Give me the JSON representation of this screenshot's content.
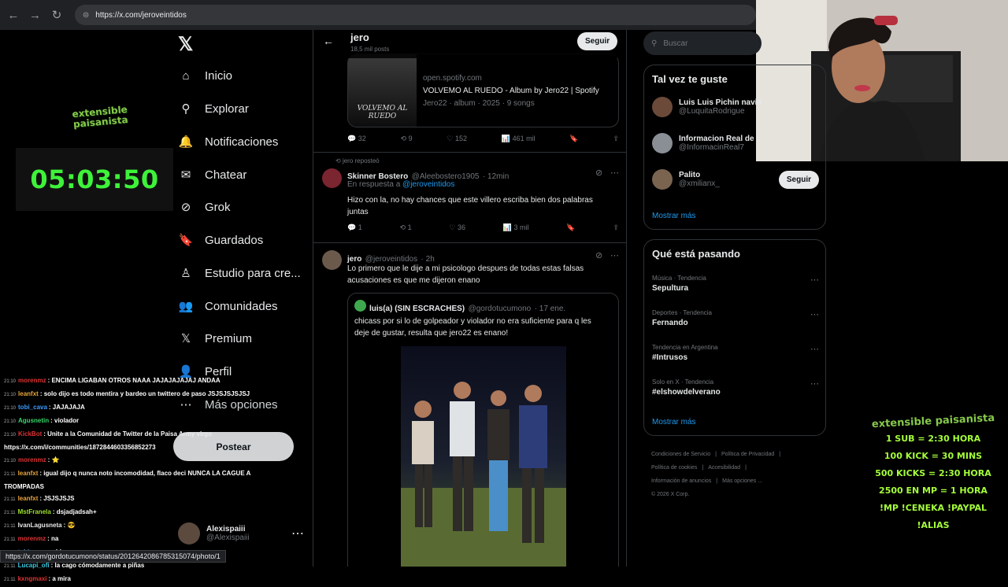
{
  "browser": {
    "url": "https://x.com/jeroveintidos",
    "status_url": "https://x.com/gordotucumono/status/2012642086785315074/photo/1"
  },
  "stream": {
    "logo_text": "extensible paisanista",
    "timer": "05:03:50",
    "chat": [
      {
        "time": "21:10",
        "user": "morenmz",
        "user_color": "#d33",
        "msg": ": ENCIMA LIGABAN OTROS NAAA JAJAJAJAJAJ ANDAA"
      },
      {
        "time": "21:10",
        "user": "leanfxt",
        "user_color": "#e8a33c",
        "msg": ": solo dijo es todo mentira y bardeo un twittero de paso JSJSJSJSJSJ"
      },
      {
        "time": "21:10",
        "user": "tobi_cava",
        "user_color": "#3b9cff",
        "msg": ": JAJAJAJA"
      },
      {
        "time": "21:10",
        "user": "Agusnetin",
        "user_color": "#36d96b",
        "msg": ": violador"
      },
      {
        "time": "21:10",
        "user": "KickBot",
        "user_color": "#d33",
        "msg": ": Unite a la Comunidad de Twitter de la Paisa Army virgo"
      },
      {
        "time": "",
        "user": "",
        "user_color": "#fff",
        "msg": "https://x.com/i/communities/1872844603356852273"
      },
      {
        "time": "21:10",
        "user": "morenmz",
        "user_color": "#d33",
        "msg": ": ⭐"
      },
      {
        "time": "21:11",
        "user": "leanfxt",
        "user_color": "#e8a33c",
        "msg": ": igual dijo q nunca noto incomodidad, flaco deci NUNCA LA CAGUE A"
      },
      {
        "time": "",
        "user": "",
        "user_color": "#fff",
        "msg": "TROMPADAS"
      },
      {
        "time": "21:11",
        "user": "leanfxt",
        "user_color": "#e8a33c",
        "msg": ": JSJSJSJS"
      },
      {
        "time": "21:11",
        "user": "MstFranela",
        "user_color": "#9be02e",
        "msg": ": dsjadjadsah+"
      },
      {
        "time": "21:11",
        "user": "IvanLagusneta",
        "user_color": "#e8e8e8",
        "msg": ": 😎"
      },
      {
        "time": "21:11",
        "user": "morenmz",
        "user_color": "#d33",
        "msg": ": na"
      },
      {
        "time": "21:11",
        "user": "tobi_cava",
        "user_color": "#3b9cff",
        "msg": ": ahi va"
      },
      {
        "time": "21:11",
        "user": "Lucapi_ofi",
        "user_color": "#3ec9e0",
        "msg": ": la cago cómodamente a piñas"
      },
      {
        "time": "21:11",
        "user": "kxngmaxi",
        "user_color": "#d33",
        "msg": ": a mira"
      }
    ],
    "overlay_logo": "extensible paisanista",
    "overlay_lines": [
      "1 SUB = 2:30 HORA",
      "100 KICK = 30 MINS",
      "500 KICKS = 2:30 HORA",
      "2500 EN MP = 1 HORA",
      "!MP !CENEKA !PAYPAL !ALIAS"
    ]
  },
  "sidebar": {
    "items": [
      {
        "label": "Inicio",
        "icon": "home-icon",
        "glyph": "⌂"
      },
      {
        "label": "Explorar",
        "icon": "search-icon",
        "glyph": "⚲"
      },
      {
        "label": "Notificaciones",
        "icon": "bell-icon",
        "glyph": "🔔"
      },
      {
        "label": "Chatear",
        "icon": "mail-icon",
        "glyph": "✉"
      },
      {
        "label": "Grok",
        "icon": "grok-icon",
        "glyph": "⊘"
      },
      {
        "label": "Guardados",
        "icon": "bookmark-icon",
        "glyph": "🔖"
      },
      {
        "label": "Estudio para cre...",
        "icon": "studio-icon",
        "glyph": "♙"
      },
      {
        "label": "Comunidades",
        "icon": "communities-icon",
        "glyph": "👥"
      },
      {
        "label": "Premium",
        "icon": "x-premium-icon",
        "glyph": "𝕏"
      },
      {
        "label": "Perfil",
        "icon": "profile-icon",
        "glyph": "👤"
      },
      {
        "label": "Más opciones",
        "icon": "more-icon",
        "glyph": "⋯"
      }
    ],
    "post_label": "Postear",
    "account_name": "Alexispaiii",
    "account_handle": "@Alexispaiii"
  },
  "feed": {
    "header_name": "jero",
    "header_posts": "18,5 mil posts",
    "follow_label": "Seguir",
    "card": {
      "domain": "open.spotify.com",
      "title": "VOLVEMO AL RUEDO - Album by Jero22 | Spotify",
      "meta": "Jero22 · album · 2025 · 9 songs",
      "art_text": "VOLVEMO AL RUEDO"
    },
    "tweet1_stats": {
      "replies": "32",
      "reposts": "9",
      "likes": "152",
      "views": "461 mil"
    },
    "tweet2": {
      "reposted_label": "jero reposteó",
      "name": "Skinner Bostero",
      "handle": "@Aleebostero1905",
      "time": "12min",
      "reply_to_label": "En respuesta a",
      "reply_to": "@jeroveintidos",
      "text": "Hizo con la, no hay chances que este villero escriba bien dos palabras juntas",
      "replies": "1",
      "reposts": "1",
      "likes": "36",
      "views": "3 mil"
    },
    "tweet3": {
      "name": "jero",
      "handle": "@jeroveintidos",
      "time": "2h",
      "text": "Lo primero que le dije a mi psicologo despues de todas estas falsas acusaciones es que me dijeron enano",
      "quote": {
        "name": "luis(a) (SIN ESCRACHES)",
        "handle": "@gordotucumono",
        "time": "17 ene.",
        "text": "chicass por si lo de golpeador y violador no era suficiente para q les deje de gustar, resulta que jero22 es enano!"
      }
    }
  },
  "right": {
    "search_placeholder": "Buscar",
    "who_title": "Tal vez te guste",
    "who": [
      {
        "name": "Luis Luis Pichin navid",
        "handle": "@LuquitaRodrigue"
      },
      {
        "name": "Informacion Real de I",
        "handle": "@InformacinReal7"
      },
      {
        "name": "Palito",
        "handle": "@xmilianx_"
      }
    ],
    "follow_label": "Seguir",
    "show_more": "Mostrar más",
    "trends_title": "Qué está pasando",
    "trends": [
      {
        "cat": "Música · Tendencia",
        "name": "Sepultura"
      },
      {
        "cat": "Deportes · Tendencia",
        "name": "Fernando"
      },
      {
        "cat": "Tendencia en Argentina",
        "name": "#Intrusos"
      },
      {
        "cat": "Solo en X · Tendencia",
        "name": "#elshowdelverano"
      }
    ],
    "footer": [
      "Condiciones de Servicio",
      "|",
      "Política de Privacidad",
      "|",
      "Política de cookies",
      "|",
      "Accesibilidad",
      "|",
      "Información de anuncios",
      "|",
      "Más opciones ...",
      "© 2026 X Corp."
    ]
  }
}
